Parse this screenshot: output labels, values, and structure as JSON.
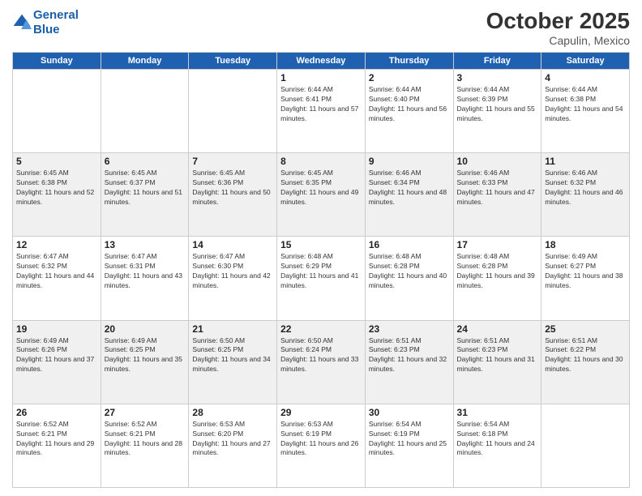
{
  "header": {
    "logo_line1": "General",
    "logo_line2": "Blue",
    "month": "October 2025",
    "location": "Capulin, Mexico"
  },
  "days_of_week": [
    "Sunday",
    "Monday",
    "Tuesday",
    "Wednesday",
    "Thursday",
    "Friday",
    "Saturday"
  ],
  "weeks": [
    [
      {
        "day": "",
        "info": ""
      },
      {
        "day": "",
        "info": ""
      },
      {
        "day": "",
        "info": ""
      },
      {
        "day": "1",
        "info": "Sunrise: 6:44 AM\nSunset: 6:41 PM\nDaylight: 11 hours and 57 minutes."
      },
      {
        "day": "2",
        "info": "Sunrise: 6:44 AM\nSunset: 6:40 PM\nDaylight: 11 hours and 56 minutes."
      },
      {
        "day": "3",
        "info": "Sunrise: 6:44 AM\nSunset: 6:39 PM\nDaylight: 11 hours and 55 minutes."
      },
      {
        "day": "4",
        "info": "Sunrise: 6:44 AM\nSunset: 6:38 PM\nDaylight: 11 hours and 54 minutes."
      }
    ],
    [
      {
        "day": "5",
        "info": "Sunrise: 6:45 AM\nSunset: 6:38 PM\nDaylight: 11 hours and 52 minutes."
      },
      {
        "day": "6",
        "info": "Sunrise: 6:45 AM\nSunset: 6:37 PM\nDaylight: 11 hours and 51 minutes."
      },
      {
        "day": "7",
        "info": "Sunrise: 6:45 AM\nSunset: 6:36 PM\nDaylight: 11 hours and 50 minutes."
      },
      {
        "day": "8",
        "info": "Sunrise: 6:45 AM\nSunset: 6:35 PM\nDaylight: 11 hours and 49 minutes."
      },
      {
        "day": "9",
        "info": "Sunrise: 6:46 AM\nSunset: 6:34 PM\nDaylight: 11 hours and 48 minutes."
      },
      {
        "day": "10",
        "info": "Sunrise: 6:46 AM\nSunset: 6:33 PM\nDaylight: 11 hours and 47 minutes."
      },
      {
        "day": "11",
        "info": "Sunrise: 6:46 AM\nSunset: 6:32 PM\nDaylight: 11 hours and 46 minutes."
      }
    ],
    [
      {
        "day": "12",
        "info": "Sunrise: 6:47 AM\nSunset: 6:32 PM\nDaylight: 11 hours and 44 minutes."
      },
      {
        "day": "13",
        "info": "Sunrise: 6:47 AM\nSunset: 6:31 PM\nDaylight: 11 hours and 43 minutes."
      },
      {
        "day": "14",
        "info": "Sunrise: 6:47 AM\nSunset: 6:30 PM\nDaylight: 11 hours and 42 minutes."
      },
      {
        "day": "15",
        "info": "Sunrise: 6:48 AM\nSunset: 6:29 PM\nDaylight: 11 hours and 41 minutes."
      },
      {
        "day": "16",
        "info": "Sunrise: 6:48 AM\nSunset: 6:28 PM\nDaylight: 11 hours and 40 minutes."
      },
      {
        "day": "17",
        "info": "Sunrise: 6:48 AM\nSunset: 6:28 PM\nDaylight: 11 hours and 39 minutes."
      },
      {
        "day": "18",
        "info": "Sunrise: 6:49 AM\nSunset: 6:27 PM\nDaylight: 11 hours and 38 minutes."
      }
    ],
    [
      {
        "day": "19",
        "info": "Sunrise: 6:49 AM\nSunset: 6:26 PM\nDaylight: 11 hours and 37 minutes."
      },
      {
        "day": "20",
        "info": "Sunrise: 6:49 AM\nSunset: 6:25 PM\nDaylight: 11 hours and 35 minutes."
      },
      {
        "day": "21",
        "info": "Sunrise: 6:50 AM\nSunset: 6:25 PM\nDaylight: 11 hours and 34 minutes."
      },
      {
        "day": "22",
        "info": "Sunrise: 6:50 AM\nSunset: 6:24 PM\nDaylight: 11 hours and 33 minutes."
      },
      {
        "day": "23",
        "info": "Sunrise: 6:51 AM\nSunset: 6:23 PM\nDaylight: 11 hours and 32 minutes."
      },
      {
        "day": "24",
        "info": "Sunrise: 6:51 AM\nSunset: 6:23 PM\nDaylight: 11 hours and 31 minutes."
      },
      {
        "day": "25",
        "info": "Sunrise: 6:51 AM\nSunset: 6:22 PM\nDaylight: 11 hours and 30 minutes."
      }
    ],
    [
      {
        "day": "26",
        "info": "Sunrise: 6:52 AM\nSunset: 6:21 PM\nDaylight: 11 hours and 29 minutes."
      },
      {
        "day": "27",
        "info": "Sunrise: 6:52 AM\nSunset: 6:21 PM\nDaylight: 11 hours and 28 minutes."
      },
      {
        "day": "28",
        "info": "Sunrise: 6:53 AM\nSunset: 6:20 PM\nDaylight: 11 hours and 27 minutes."
      },
      {
        "day": "29",
        "info": "Sunrise: 6:53 AM\nSunset: 6:19 PM\nDaylight: 11 hours and 26 minutes."
      },
      {
        "day": "30",
        "info": "Sunrise: 6:54 AM\nSunset: 6:19 PM\nDaylight: 11 hours and 25 minutes."
      },
      {
        "day": "31",
        "info": "Sunrise: 6:54 AM\nSunset: 6:18 PM\nDaylight: 11 hours and 24 minutes."
      },
      {
        "day": "",
        "info": ""
      }
    ]
  ]
}
